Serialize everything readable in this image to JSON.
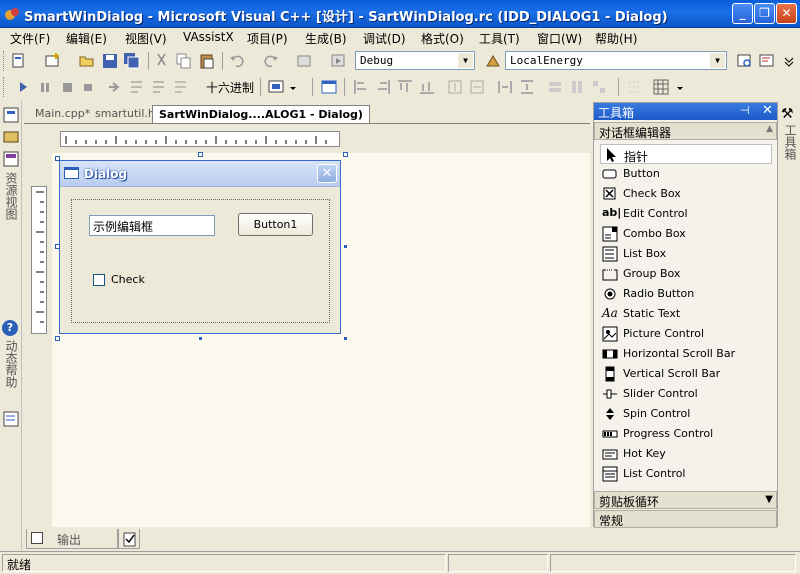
{
  "window": {
    "title": "SmartWinDialog - Microsoft Visual C++ [设计] - SartWinDialog.rc (IDD_DIALOG1 - Dialog)",
    "minimize": "_",
    "maximize": "❐",
    "close": "✕"
  },
  "menu": [
    "文件(F)",
    "编辑(E)",
    "视图(V)",
    "VAssistX",
    "项目(P)",
    "生成(B)",
    "调试(D)",
    "格式(O)",
    "工具(T)",
    "窗口(W)",
    "帮助(H)"
  ],
  "toolbar": {
    "config": "Debug",
    "solution": "LocalEnergy",
    "hex_label": "十六进制"
  },
  "left_panels": {
    "resource_view": "资源视图",
    "dynamic_help": "动态帮助"
  },
  "tabs": [
    {
      "label": "Main.cpp*"
    },
    {
      "label": "smartutil.h"
    },
    {
      "label": "SartWinDialog....ALOG1 - Dialog)"
    }
  ],
  "dialog": {
    "title": "Dialog",
    "edit_text": "示例编辑框",
    "button_label": "Button1",
    "check_label": "Check"
  },
  "toolbox": {
    "title": "工具箱",
    "section": "对话框编辑器",
    "items": [
      "指针",
      "Button",
      "Check Box",
      "Edit Control",
      "Combo Box",
      "List Box",
      "Group Box",
      "Radio Button",
      "Static Text",
      "Picture Control",
      "Horizontal Scroll Bar",
      "Vertical Scroll Bar",
      "Slider Control",
      "Spin Control",
      "Progress Control",
      "Hot Key",
      "List Control"
    ],
    "clipboard_ring": "剪贴板循环",
    "general": "常规"
  },
  "right_strip_label": "工具箱",
  "output_tab": "输出",
  "status": "就绪",
  "colors": {
    "title_bar": "#0a5fd8",
    "selection": "#2a5fb8"
  }
}
